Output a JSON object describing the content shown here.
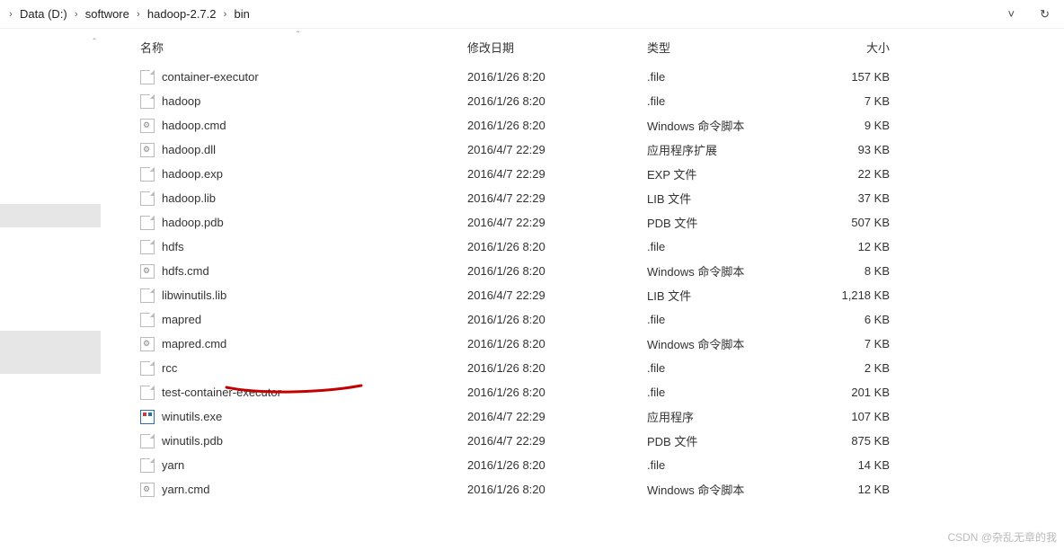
{
  "breadcrumb": [
    {
      "label": "Data (D:)"
    },
    {
      "label": "softwore"
    },
    {
      "label": "hadoop-2.7.2"
    },
    {
      "label": "bin"
    }
  ],
  "toolbar": {
    "dropdown_glyph": "˅",
    "refresh_glyph": "↻"
  },
  "columns": {
    "name": "名称",
    "modified": "修改日期",
    "type": "类型",
    "size": "大小",
    "sort_glyph": "ˆ"
  },
  "files": [
    {
      "icon": "file",
      "name": "container-executor",
      "date": "2016/1/26 8:20",
      "type": ".file",
      "size": "157 KB"
    },
    {
      "icon": "file",
      "name": "hadoop",
      "date": "2016/1/26 8:20",
      "type": ".file",
      "size": "7 KB"
    },
    {
      "icon": "cmd",
      "name": "hadoop.cmd",
      "date": "2016/1/26 8:20",
      "type": "Windows 命令脚本",
      "size": "9 KB"
    },
    {
      "icon": "dll",
      "name": "hadoop.dll",
      "date": "2016/4/7 22:29",
      "type": "应用程序扩展",
      "size": "93 KB"
    },
    {
      "icon": "file",
      "name": "hadoop.exp",
      "date": "2016/4/7 22:29",
      "type": "EXP 文件",
      "size": "22 KB"
    },
    {
      "icon": "file",
      "name": "hadoop.lib",
      "date": "2016/4/7 22:29",
      "type": "LIB 文件",
      "size": "37 KB"
    },
    {
      "icon": "file",
      "name": "hadoop.pdb",
      "date": "2016/4/7 22:29",
      "type": "PDB 文件",
      "size": "507 KB"
    },
    {
      "icon": "file",
      "name": "hdfs",
      "date": "2016/1/26 8:20",
      "type": ".file",
      "size": "12 KB"
    },
    {
      "icon": "cmd",
      "name": "hdfs.cmd",
      "date": "2016/1/26 8:20",
      "type": "Windows 命令脚本",
      "size": "8 KB"
    },
    {
      "icon": "file",
      "name": "libwinutils.lib",
      "date": "2016/4/7 22:29",
      "type": "LIB 文件",
      "size": "1,218 KB"
    },
    {
      "icon": "file",
      "name": "mapred",
      "date": "2016/1/26 8:20",
      "type": ".file",
      "size": "6 KB"
    },
    {
      "icon": "cmd",
      "name": "mapred.cmd",
      "date": "2016/1/26 8:20",
      "type": "Windows 命令脚本",
      "size": "7 KB"
    },
    {
      "icon": "file",
      "name": "rcc",
      "date": "2016/1/26 8:20",
      "type": ".file",
      "size": "2 KB"
    },
    {
      "icon": "file",
      "name": "test-container-executor",
      "date": "2016/1/26 8:20",
      "type": ".file",
      "size": "201 KB"
    },
    {
      "icon": "exe",
      "name": "winutils.exe",
      "date": "2016/4/7 22:29",
      "type": "应用程序",
      "size": "107 KB"
    },
    {
      "icon": "file",
      "name": "winutils.pdb",
      "date": "2016/4/7 22:29",
      "type": "PDB 文件",
      "size": "875 KB"
    },
    {
      "icon": "file",
      "name": "yarn",
      "date": "2016/1/26 8:20",
      "type": ".file",
      "size": "14 KB"
    },
    {
      "icon": "cmd",
      "name": "yarn.cmd",
      "date": "2016/1/26 8:20",
      "type": "Windows 命令脚本",
      "size": "12 KB"
    }
  ],
  "watermark": "CSDN @杂乱无章的我"
}
